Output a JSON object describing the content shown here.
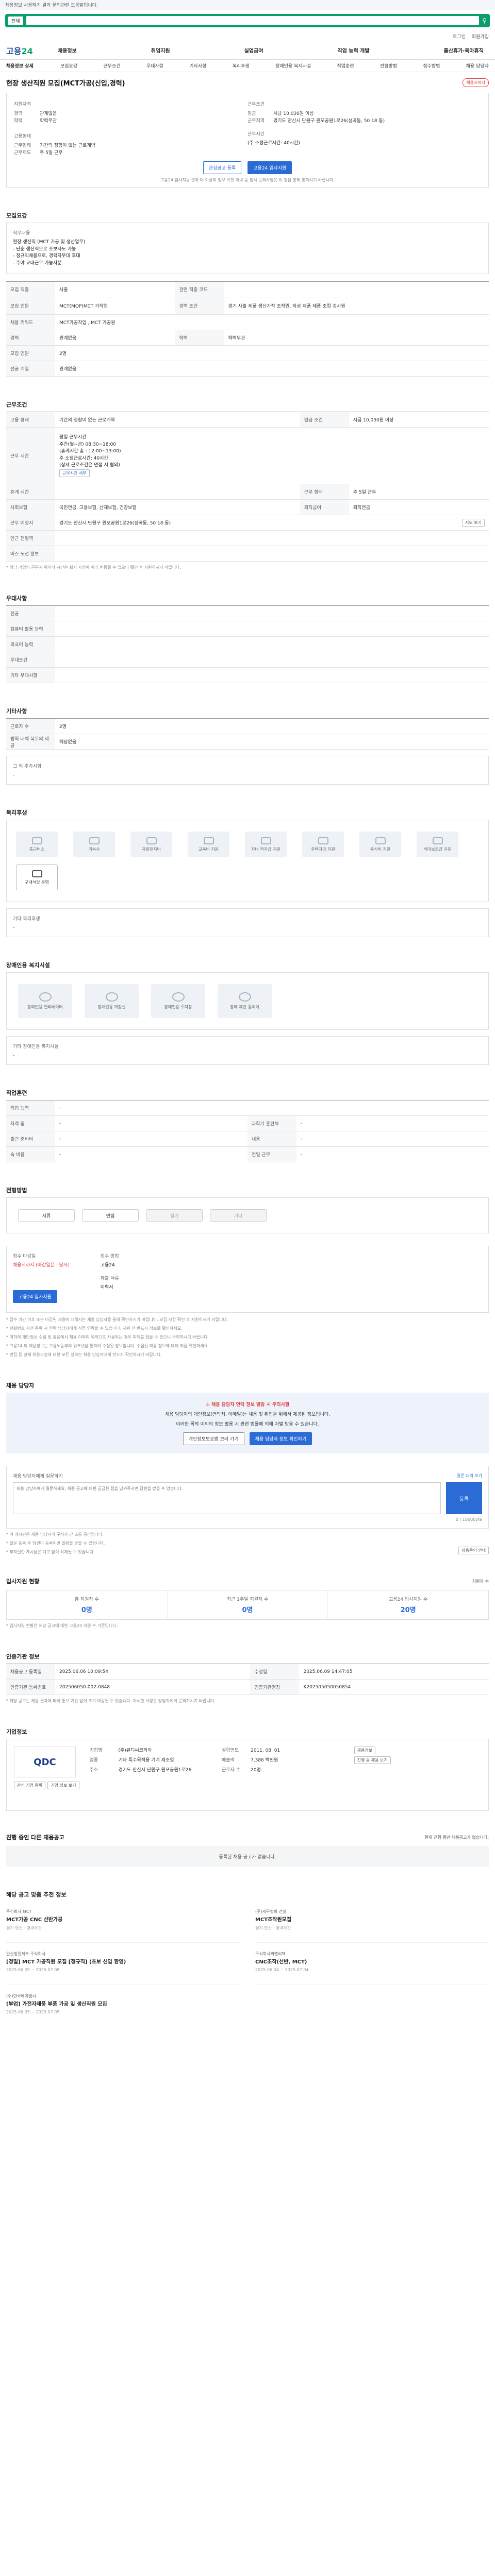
{
  "topbar": {
    "text": "채용정보 사용하기 결과 문의관련 도움말입니다."
  },
  "search": {
    "select": "전체",
    "placeholder": "",
    "button": "검색"
  },
  "util": [
    "로그인",
    "회원가입"
  ],
  "logo": {
    "a": "고용",
    "b": "24"
  },
  "gnb": [
    "채용정보",
    "취업지원",
    "실업급여",
    "직업 능력 개발",
    "출산휴가·육아휴직"
  ],
  "pagebar": {
    "title": "채용정보 상세",
    "tabs": [
      "모집요강",
      "근무조건",
      "우대사항",
      "기타사항",
      "복리후생",
      "장애인용 복지시설",
      "직업훈련",
      "전형방법",
      "접수방법",
      "채용 담당자"
    ]
  },
  "job": {
    "title": "현장 생산직원 모집(MCT가공(신입,경력)",
    "badge": "채용시까지",
    "left": {
      "h": "지원자격",
      "exp_k": "경력",
      "exp_v": "관계없음",
      "edu_k": "학력",
      "edu_v": "학력무관",
      "cond_h": "고용형태",
      "cond_k": "근무형태",
      "cond_v": "기간의 정함이 없는 근로계약",
      "work_k": "근무제도",
      "work_v": "주 5일 근무"
    },
    "right": {
      "h": "근무조건",
      "pay_k": "임금",
      "pay_v": "시급 10,030원 이상",
      "loc_k": "근무지역",
      "loc_v": "경기도 안산시 단원구 원포공원1로26(성곡동, 50 18 동)",
      "time_h": "근무시간",
      "time_v": "(주 소정근로시간: 40시간)"
    },
    "btn1": "관심공고 등록",
    "btn2": "고용24 입사지원",
    "note": "고용24 입사지원 결과 더 이상의 정보 확인 이력 중 임시 문의사항은 이 창을 통해 통하시기 바랍니다."
  },
  "recruit": {
    "h": "모집요강",
    "desc_h": "직무내용",
    "desc": [
      "현장 생산직 (MCT 가공 및 생산업무)",
      "- 단순 생산직으로 초보자도 가능",
      "- 정규직채용으로, 경력자우대 후대",
      "- 주야 교대근무 가능자분"
    ],
    "rows": [
      [
        "모집 직종",
        "사출",
        "관련 직종 코드",
        ""
      ],
      [
        "모집 인원",
        "MCT(MOP)MCT 가작업",
        "경력 조건",
        "경기 사출 제품 생산가작 조작원, 하공 제품 제품 조립 검사원"
      ],
      [
        "채용 키워드",
        "MCT가공작업 , MCT 가공원",
        "",
        ""
      ],
      [
        "경력",
        "관계없음",
        "학력",
        "학력무관"
      ],
      [
        "모집 인원",
        "2명",
        "",
        ""
      ],
      [
        "전공 계열",
        "관계없음",
        "",
        ""
      ]
    ]
  },
  "conditions": {
    "h": "근무조건",
    "rows": [
      [
        "고용 형태",
        "기간의 정함이 없는 근로계약",
        "임금 조건",
        "시급 10,030원 이상"
      ],
      [
        "근무 시간",
        "평일 근무시간",
        "",
        ""
      ]
    ],
    "time_detail": [
      "주간(월~금)  08:30~18:00",
      "(휴게시간 총 : 12:00~13:00)",
      "주 소정근로시간: 40시간",
      "(상세 근로조건은 면접 시 협의)"
    ],
    "time_link": "근무시간 세부",
    "rows2": [
      [
        "휴게 시간",
        "",
        "근무 형태",
        "주 5일 근무"
      ],
      [
        "사회보험",
        "국민연금, 고용보험, 산재보험, 건강보험",
        "퇴직급여",
        "퇴직연금"
      ],
      [
        "근무 예정지",
        "경기도 안산시 단원구 원포공원1로26(성곡동, 50 18 동)",
        "",
        ""
      ],
      [
        "인근 전철역",
        "",
        "",
        ""
      ],
      [
        "버스 노선 정보",
        "",
        "",
        ""
      ]
    ],
    "map_btn": "지도 보기",
    "note": "* 해당 기업의 근무지 위치와 시간은 회사 사정에 따라 변동될 수 있으니 확인 후 지원하시기 바랍니다."
  },
  "pref": {
    "h": "우대사항",
    "rows": [
      [
        "전공",
        ""
      ],
      [
        "컴퓨터 활용 능력",
        ""
      ],
      [
        "외국어 능력",
        ""
      ],
      [
        "우대조건",
        ""
      ],
      [
        "기타 우대사항",
        ""
      ]
    ]
  },
  "etc": {
    "h": "기타사항",
    "rows": [
      [
        "근로자 수",
        "2명"
      ],
      [
        "병역 대체 복무의 제공",
        "해당없음"
      ]
    ],
    "sub_h": "그 외 추가사항",
    "sub_v": "-"
  },
  "welfare": {
    "h": "복리후생",
    "items": [
      "통근버스",
      "기숙사",
      "차량유지비",
      "교육비 지원",
      "자녀 학자금 지원",
      "주택자금 지원",
      "중식비 지원",
      "식대보조금 지원",
      "구내식당 운영"
    ],
    "dark_index": 8,
    "other_h": "기타 복리후생",
    "other_v": "-"
  },
  "disability": {
    "h": "장애인용 복지시설",
    "items": [
      "장애인용 엘리베이터",
      "장애인용 화장실",
      "장애인용 주차장",
      "장애 제반 휠체어"
    ],
    "other_h": "기타 장애인용 복지시설",
    "other_v": "-"
  },
  "training": {
    "h": "직업훈련",
    "rows": [
      [
        "직업 능력",
        "-",
        "",
        ""
      ],
      [
        "자격 증",
        "-",
        "과학기 훈련처",
        "-"
      ],
      [
        "출근 준비비",
        "-",
        "내용",
        "-"
      ],
      [
        "숙 비용",
        "-",
        "전일 근무",
        "-"
      ]
    ]
  },
  "screening": {
    "h": "전형방법",
    "steps": [
      "서류",
      "면접",
      "필기",
      "기타"
    ],
    "off": [
      2,
      3
    ]
  },
  "apply": {
    "period_k": "접수 마감일",
    "period_v": "채용시까지 (마감일은 : 당사)",
    "method_k": "접수 방법",
    "method_v": "고용24",
    "docs_k": "제출 서류",
    "docs_v": "이력서",
    "btn": "고용24 입사지원",
    "notes": [
      "* 접수 기간 이후 또는 마감된 채용에 대해서는 채용 담당자를 통해 확인하시기 바랍니다. 모집 사항 확인 후 지원하시기 바랍니다.",
      "* 전화번호 사전 등록 시 연락 담당자에게 직접 연락할 수 있습니다. 지원 전 반드시 정보를 확인하세요.",
      "* 귀하의 개인정보 수집 및 활용에서 채용 이외의 목적으로 사용되는 경우 피해를 입을 수 있으니 주의하시기 바랍니다.",
      "* 고용24 의 채용정보는 고용노동부의 워크넷을 통하여 수집된 정보입니다. 수집된 채용 정보에 대해 직접 확인하세요.",
      "* 면접 등 실제 채용과정에 대한 모든 정보는 채용 담당자에게 반드시 확인하시기 바랍니다."
    ]
  },
  "contact": {
    "h": "채용 담당자",
    "alert_title": "채용 담당자 연락 정보 열람 시 주의사항",
    "alert_lines": [
      "채용 담당자의 개인정보(연락처, 이메일)는 채용 및 취업을 위해서 제공된 정보입니다.",
      "이러한 목적 이외의 정보 활용 시 관련 법률에 의해 처벌 받을 수 있습니다."
    ],
    "btn1": "개인정보보호법 보러 가기",
    "btn2": "채용 담당자 정보 확인하기"
  },
  "qna": {
    "h": "채용 담당자에게 질문하기",
    "link": "질문 내역 보기",
    "placeholder": "채용 담당자에게 질문하세요. 채용 공고에 대한 궁금한 점을 남겨주시면 답변을 받을 수 있습니다.",
    "count": "0 / 1000byte",
    "btn": "등록",
    "notes": [
      "* 이 게시판은 채용 담당자와 구직자 간 소통 공간입니다.",
      "* 질문 등록 후 답변이 등록되면 알림을 받을 수 있습니다.",
      "* 부적절한 게시물은 예고 없이 삭제될 수 있습니다."
    ],
    "notes_btn": "채용문의 안내"
  },
  "stats": {
    "h": "입사지원 현황",
    "count_label": "지원자 수",
    "items": [
      {
        "k": "총 지원자 수",
        "v": "0명"
      },
      {
        "k": "최근 1주일 지원자 수",
        "v": "0명"
      },
      {
        "k": "고용24 입사지원 수",
        "v": "20명"
      }
    ],
    "note": "* 입사지원 현황은 해당 공고에 대한 고용24 지원 수 기준입니다."
  },
  "info": {
    "h": "인증기관 정보",
    "rows": [
      [
        "채용공고 등록일",
        "2025.06.06 10:09:54",
        "수정일",
        "2025.06.09 14:47:05"
      ],
      [
        "인증기관 등록번호",
        "202506050-002-0848",
        "인증기관명칭",
        "K202505050050854"
      ]
    ],
    "note": "* 해당 공고는 채용 결과에 따라 통보 기간 없이 조기 마감될 수 있습니다. 자세한 사항은 담당자에게 문의하시기 바랍니다."
  },
  "company": {
    "h": "기업정보",
    "logo": "QDC",
    "btn1": "관심 기업 등록",
    "btn2": "기업 정보 보기",
    "rows": [
      [
        "기업명",
        "(주)큐디씨코리아"
      ],
      [
        "업종",
        "기타 특수목적용 기계 제조업"
      ],
      [
        "주소",
        "경기도 안산시 단원구 원포공원1로26"
      ],
      [
        "설립연도",
        "2011. 08. 01"
      ],
      [
        "매출액",
        "7,386 백만원"
      ],
      [
        "근로자 수",
        "20명"
      ]
    ],
    "side": [
      "채용정보",
      "진행 중 채용 보기"
    ]
  },
  "other": {
    "h": "진행 중인 다른 채용공고",
    "sub": "현재 진행 중인 채용공고가 없습니다.",
    "empty": "등록된 채용 공고가 없습니다."
  },
  "recommend": {
    "h": "해당 공고 맞춤 추천 정보",
    "items": [
      {
        "co": "주식회사 MCT",
        "title": "MCT가공 CNC 선반가공",
        "meta": "경기 안산 · 경력무관"
      },
      {
        "co": "(주)세무협회 건설",
        "title": "MCT조작원모집",
        "meta": "경기 안산 · 경력무관"
      },
      {
        "co": "일산정밀제조 주식회사",
        "title": "[정밀] MCT 가공직원 모집 [정규직] (초보 신입 환영)",
        "meta": "2025.06.09 ~ 2025.07.08"
      },
      {
        "co": "주식회사씨엔씨텍",
        "title": "CNC조작(선반, MCT)",
        "meta": "2025.06.04 ~ 2025.07.04"
      },
      {
        "co": "(주)한국에이엠시",
        "title": "[부업] 가전자제품 부품 가공 및 생산직원 모집",
        "meta": "2025.06.05 ~ 2025.07.05"
      }
    ]
  }
}
